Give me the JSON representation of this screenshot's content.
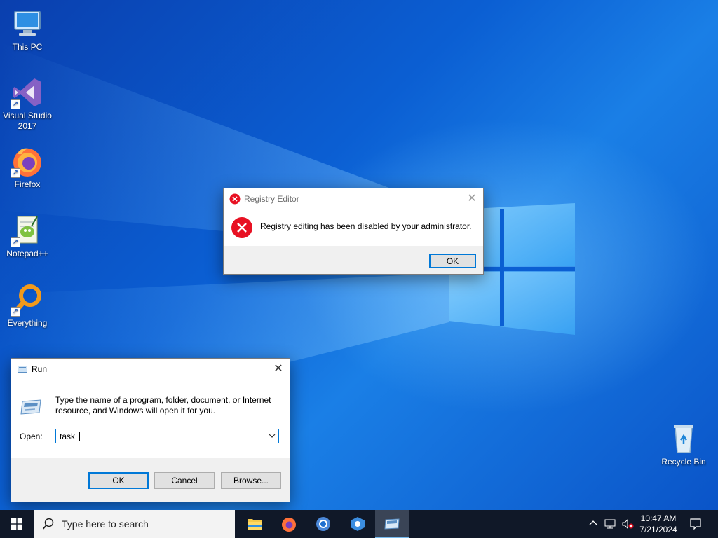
{
  "desktop": {
    "icons": [
      {
        "label": "This PC"
      },
      {
        "label": "Visual Studio\n2017"
      },
      {
        "label": "Firefox"
      },
      {
        "label": "Notepad++"
      },
      {
        "label": "Everything"
      },
      {
        "label": "Recycle Bin"
      }
    ]
  },
  "registry_dialog": {
    "title": "Registry Editor",
    "message": "Registry editing has been disabled by your administrator.",
    "ok_label": "OK",
    "close_glyph": "✕"
  },
  "run_dialog": {
    "title": "Run",
    "description": "Type the name of a program, folder, document, or Internet resource, and Windows will open it for you.",
    "open_label": "Open:",
    "input_value": "task",
    "ok_label": "OK",
    "cancel_label": "Cancel",
    "browse_label": "Browse...",
    "close_glyph": "✕"
  },
  "taskbar": {
    "search_placeholder": "Type here to search",
    "pinned": [
      "file-explorer",
      "firefox",
      "chrome",
      "teams",
      "run"
    ],
    "tray": {
      "time": "10:47 AM",
      "date": "7/21/2024"
    }
  },
  "colors": {
    "accent": "#0078d7",
    "error_red": "#e81123",
    "taskbar": "#101828"
  }
}
